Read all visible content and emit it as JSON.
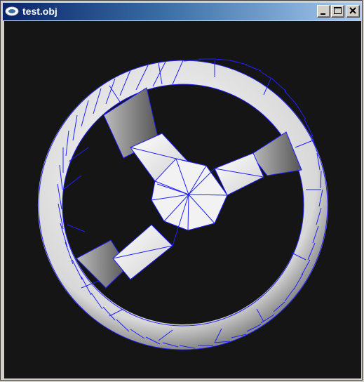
{
  "window": {
    "title": "test.obj",
    "icon": "app-window-icon",
    "controls": {
      "minimize": "minimize-icon",
      "maximize": "maximize-icon",
      "close": "close-icon"
    }
  },
  "viewport": {
    "background": "#151515",
    "mesh_color": "#2020ff",
    "surface_color": "#e8e8e8"
  }
}
